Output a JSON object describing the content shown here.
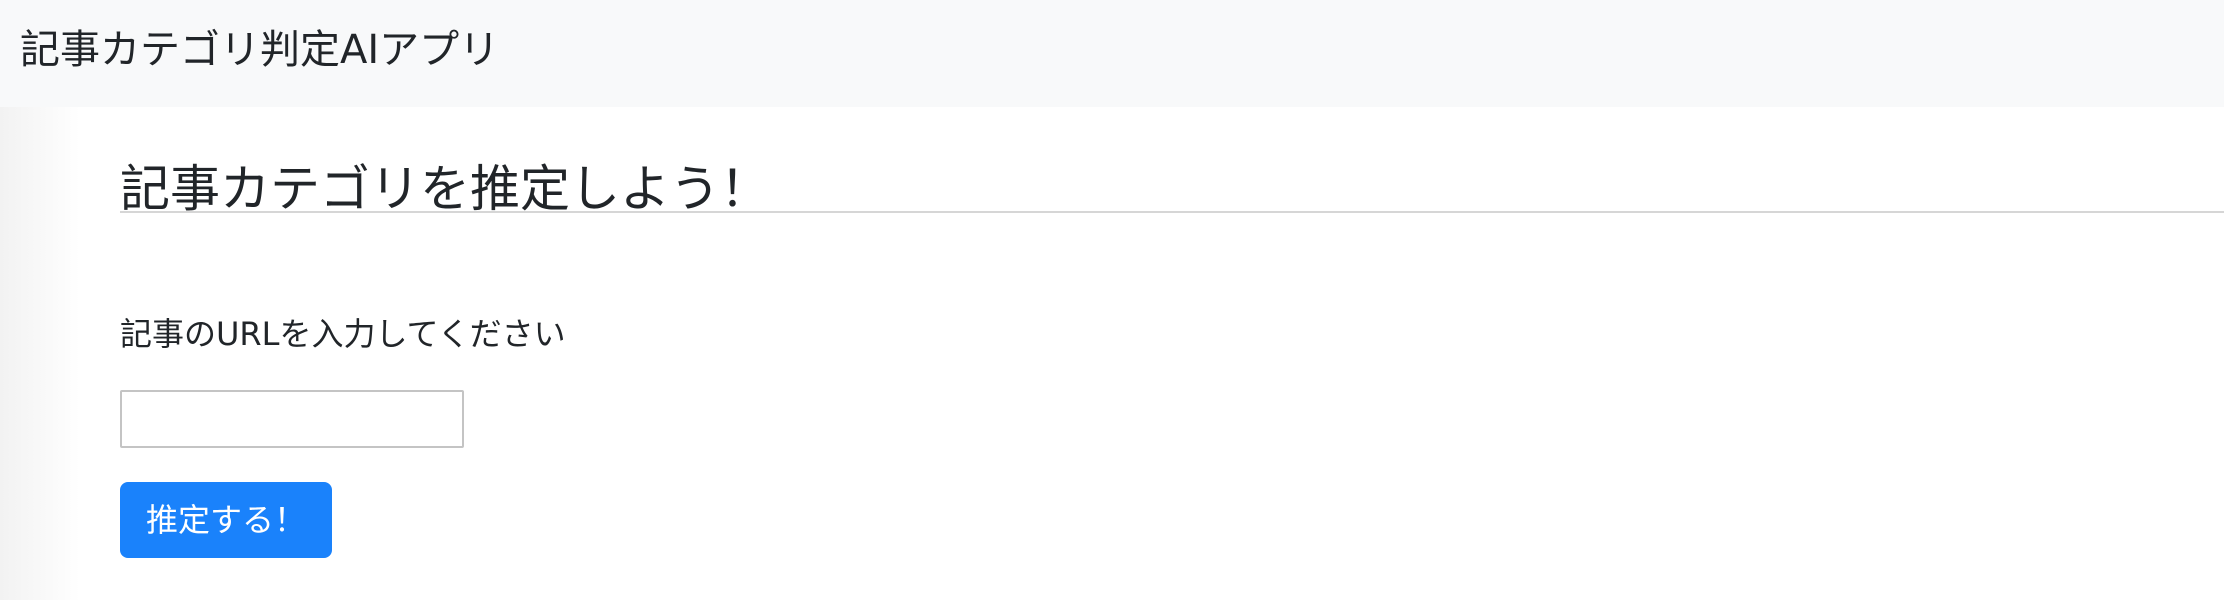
{
  "navbar": {
    "brand": "記事カテゴリ判定AIアプリ"
  },
  "main": {
    "title": "記事カテゴリを推定しよう！",
    "url_label": "記事のURLを入力してください",
    "url_input_value": "",
    "submit_label": "推定する！"
  },
  "colors": {
    "navbar_bg": "#f8f9fa",
    "primary_button": "#1a82fb",
    "text": "#212529"
  }
}
